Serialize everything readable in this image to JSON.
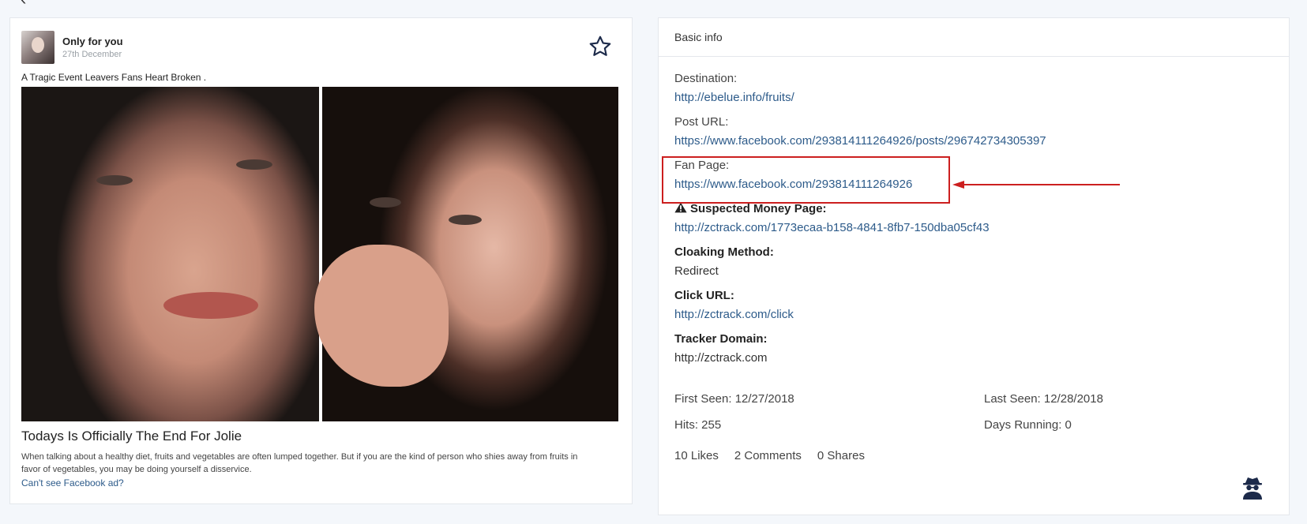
{
  "ad": {
    "page_name": "Only for you",
    "date": "27th December",
    "post_text": "A Tragic Event Leavers Fans Heart Broken .",
    "headline": "Todays Is Officially The End For Jolie",
    "description": "When talking about a healthy diet, fruits and vegetables are often lumped together. But if you are the kind of person who shies away from fruits in favor of vegetables, you may be doing yourself a disservice.",
    "cant_see_link": "Can't see Facebook ad?",
    "image_name": "ad-image",
    "favorite_icon": "star-outline-icon"
  },
  "info": {
    "title": "Basic info",
    "destination_label": "Destination:",
    "destination_value": "http://ebelue.info/fruits/",
    "post_url_label": "Post URL:",
    "post_url_value": "https://www.facebook.com/293814111264926/posts/296742734305397",
    "fan_page_label": "Fan Page:",
    "fan_page_value": "https://www.facebook.com/293814111264926",
    "money_page_label": "Suspected Money Page:",
    "money_page_value": "http://zctrack.com/1773ecaa-b158-4841-8fb7-150dba05cf43",
    "cloaking_label": "Cloaking Method:",
    "cloaking_value": "Redirect",
    "click_url_label": "Click URL:",
    "click_url_value": "http://zctrack.com/click",
    "tracker_label": "Tracker Domain:",
    "tracker_value": "http://zctrack.com",
    "first_seen": "First Seen: 12/27/2018",
    "last_seen": "Last Seen: 12/28/2018",
    "hits": "Hits: 255",
    "days_running": "Days Running: 0",
    "likes": "10 Likes",
    "comments": "2 Comments",
    "shares": "0 Shares",
    "warning_icon": "warning-triangle-icon",
    "spy_icon": "spy-icon"
  },
  "annotation": {
    "color": "#cc1f1f"
  },
  "colors": {
    "link": "#2d5b8a",
    "background": "#f4f7fb"
  }
}
